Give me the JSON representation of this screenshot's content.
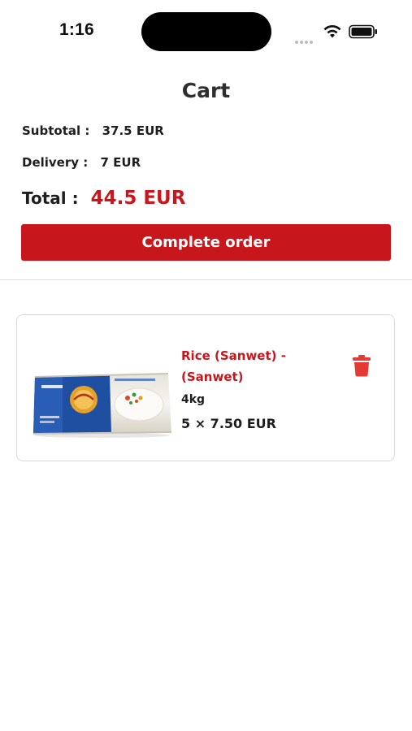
{
  "status_bar": {
    "time": "1:16"
  },
  "header": {
    "title": "Cart"
  },
  "summary": {
    "subtotal_label": "Subtotal :",
    "subtotal_value": "37.5 EUR",
    "delivery_label": "Delivery :",
    "delivery_value": "7 EUR",
    "total_label": "Total :",
    "total_value": "44.5 EUR"
  },
  "actions": {
    "complete_order_label": "Complete order"
  },
  "cart_items": [
    {
      "name": "Rice (Sanwet)  - (Sanwet)",
      "weight": "4kg",
      "qty_price": "5 × 7.50 EUR",
      "image_icon": "rice-bag-image",
      "delete_icon": "trash-icon"
    }
  ],
  "colors": {
    "accent": "#c8161d",
    "delete_icon": "#e53935",
    "text": "#1e1e1e",
    "divider": "#dddddd"
  }
}
